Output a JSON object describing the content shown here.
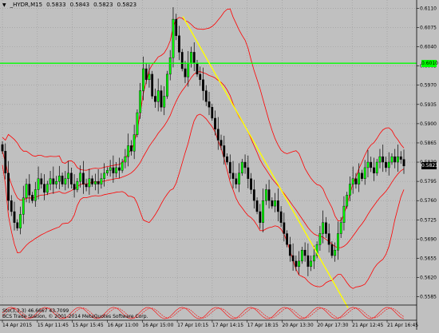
{
  "header": {
    "symbol": "_HYDR,M15",
    "ohlc": [
      "0.5833",
      "0.5843",
      "0.5823",
      "0.5823"
    ]
  },
  "price_axis": {
    "labels": [
      "0.6110",
      "0.6075",
      "0.6040",
      "0.6005",
      "0.5970",
      "0.5935",
      "0.5900",
      "0.5865",
      "0.5830",
      "0.5795",
      "0.5760",
      "0.5725",
      "0.5690",
      "0.5655",
      "0.5620",
      "0.5585"
    ],
    "current_price": "0.5823",
    "level_price": "0.6010",
    "current_price_color": "#000000",
    "level_color": "#00ff00"
  },
  "time_axis": {
    "labels": [
      "14 Apr 2015",
      "15 Apr 11:45",
      "15 Apr 15:45",
      "16 Apr 11:00",
      "16 Apr 15:00",
      "17 Apr 10:15",
      "17 Apr 14:15",
      "17 Apr 18:15",
      "20 Apr 13:30",
      "20 Apr 17:30",
      "21 Apr 12:45",
      "21 Apr 16:45"
    ]
  },
  "subwindow": {
    "indicator": "Sto(3,3,3) 46.6667 43.7099",
    "copyright": "BCS Trade Station, © 2001-2014 MetaQuotes Software Corp."
  },
  "colors": {
    "background": "#c0c0c0",
    "bull": "#00ff00",
    "bear": "#000000",
    "bollinger": "#ff0000",
    "trendline": "#ffff00",
    "grid": "#999999"
  },
  "chart_data": {
    "type": "candlestick",
    "symbol": "_HYDR",
    "timeframe": "M15",
    "ylim": [
      0.557,
      0.6125
    ],
    "horizontal_level": 0.601,
    "trendline": {
      "from": 0.6095,
      "to": 0.5565
    },
    "close": [
      0.585,
      0.581,
      0.576,
      0.574,
      0.572,
      0.571,
      0.5735,
      0.5765,
      0.579,
      0.577,
      0.576,
      0.578,
      0.58,
      0.579,
      0.5775,
      0.579,
      0.58,
      0.579,
      0.5795,
      0.5805,
      0.579,
      0.58,
      0.581,
      0.579,
      0.578,
      0.5795,
      0.581,
      0.579,
      0.5785,
      0.58,
      0.579,
      0.5795,
      0.579,
      0.58,
      0.581,
      0.5815,
      0.582,
      0.581,
      0.582,
      0.5815,
      0.583,
      0.584,
      0.586,
      0.585,
      0.588,
      0.592,
      0.596,
      0.6,
      0.598,
      0.599,
      0.595,
      0.594,
      0.596,
      0.593,
      0.595,
      0.599,
      0.602,
      0.609,
      0.606,
      0.603,
      0.6,
      0.5985,
      0.601,
      0.603,
      0.601,
      0.599,
      0.598,
      0.596,
      0.594,
      0.593,
      0.591,
      0.589,
      0.587,
      0.586,
      0.584,
      0.583,
      0.581,
      0.58,
      0.579,
      0.581,
      0.583,
      0.582,
      0.58,
      0.578,
      0.576,
      0.574,
      0.572,
      0.576,
      0.578,
      0.576,
      0.575,
      0.576,
      0.574,
      0.572,
      0.57,
      0.568,
      0.566,
      0.565,
      0.564,
      0.565,
      0.567,
      0.566,
      0.564,
      0.565,
      0.566,
      0.568,
      0.57,
      0.572,
      0.57,
      0.568,
      0.566,
      0.567,
      0.57,
      0.572,
      0.575,
      0.577,
      0.579,
      0.58,
      0.579,
      0.581,
      0.58,
      0.582,
      0.583,
      0.582,
      0.581,
      0.583,
      0.584,
      0.583,
      0.582,
      0.583,
      0.584,
      0.583,
      0.584,
      0.5835,
      0.5823
    ],
    "stochastic": {
      "k": 46.6667,
      "d": 43.7099
    }
  }
}
